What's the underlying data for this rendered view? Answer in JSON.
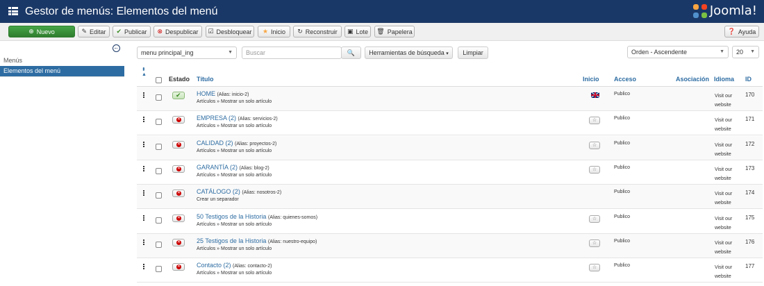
{
  "header": {
    "title": "Gestor de menús: Elementos del menú",
    "logo": "Joomla!"
  },
  "toolbar": {
    "new": "Nuevo",
    "edit": "Editar",
    "publish": "Publicar",
    "unpublish": "Despublicar",
    "checkin": "Desbloquear",
    "home": "Inicio",
    "rebuild": "Reconstruir",
    "batch": "Lote",
    "trash": "Papelera",
    "help": "Ayuda"
  },
  "sidebar": {
    "section": "Menús",
    "active": "Elementos del menú"
  },
  "filters": {
    "menu": "menu principal_ing",
    "search_placeholder": "Buscar",
    "tools": "Herramientas de búsqueda",
    "clear": "Limpiar",
    "ordering": "Orden - Ascendente",
    "limit": "20"
  },
  "columns": {
    "status": "Estado",
    "title": "Título",
    "home": "Inicio",
    "access": "Acceso",
    "association": "Asociación",
    "language": "Idioma",
    "id": "ID"
  },
  "rows": [
    {
      "title": "HOME",
      "alias": "(Alias: inicio-2)",
      "type": "Artículos » Mostrar un solo artículo",
      "status": "published",
      "home": "flag-uk",
      "access": "Publico",
      "lang1": "Visit our",
      "lang2": "website",
      "id": "170"
    },
    {
      "title": "EMPRESA (2)",
      "alias": "(Alias: servicios-2)",
      "type": "Artículos » Mostrar un solo artículo",
      "status": "unpublished",
      "home": "star",
      "access": "Publico",
      "lang1": "Visit our",
      "lang2": "website",
      "id": "171"
    },
    {
      "title": "CALIDAD (2)",
      "alias": "(Alias: proyectos-2)",
      "type": "Artículos » Mostrar un solo artículo",
      "status": "unpublished",
      "home": "star",
      "access": "Publico",
      "lang1": "Visit our",
      "lang2": "website",
      "id": "172"
    },
    {
      "title": "GARANTÍA (2)",
      "alias": "(Alias: blog-2)",
      "type": "Artículos » Mostrar un solo artículo",
      "status": "unpublished",
      "home": "star",
      "access": "Publico",
      "lang1": "Visit our",
      "lang2": "website",
      "id": "173"
    },
    {
      "title": "CATÁLOGO (2)",
      "alias": "(Alias: nosotros-2)",
      "type": "Crear un separador",
      "status": "unpublished",
      "home": "",
      "access": "Publico",
      "lang1": "Visit our",
      "lang2": "website",
      "id": "174"
    },
    {
      "title": "50 Testigos de la Historia",
      "alias": "(Alias: quienes-somos)",
      "type": "Artículos » Mostrar un solo artículo",
      "status": "unpublished",
      "home": "star",
      "access": "Publico",
      "lang1": "Visit our",
      "lang2": "website",
      "id": "175"
    },
    {
      "title": "25 Testigos de la Historia",
      "alias": "(Alias: nuestro-equipo)",
      "type": "Artículos » Mostrar un solo artículo",
      "status": "unpublished",
      "home": "star",
      "access": "Publico",
      "lang1": "Visit our",
      "lang2": "website",
      "id": "176"
    },
    {
      "title": "Contacto (2)",
      "alias": "(Alias: contacto-2)",
      "type": "Artículos » Mostrar un solo artículo",
      "status": "unpublished",
      "home": "star",
      "access": "Publico",
      "lang1": "Visit our",
      "lang2": "website",
      "id": "177"
    }
  ]
}
